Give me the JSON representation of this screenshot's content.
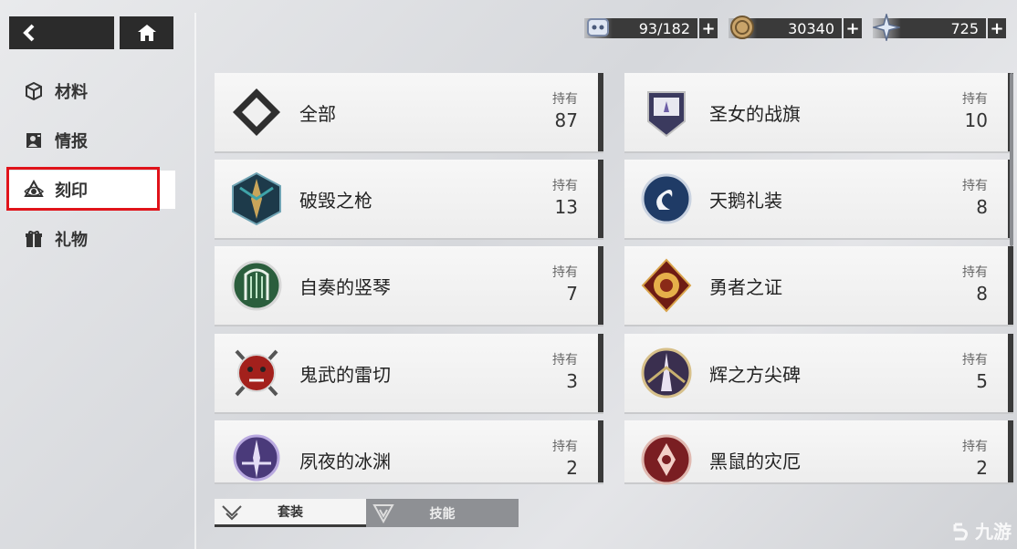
{
  "resources": [
    {
      "id": "stamina",
      "value": "93/182",
      "icon": "stamina-icon"
    },
    {
      "id": "coin",
      "value": "30340",
      "icon": "coin-icon"
    },
    {
      "id": "crystal",
      "value": "725",
      "icon": "crystal-icon"
    }
  ],
  "sidebar": {
    "items": [
      {
        "label": "材料",
        "icon": "cube-icon"
      },
      {
        "label": "情报",
        "icon": "profile-icon"
      },
      {
        "label": "刻印",
        "icon": "eye-emblem-icon",
        "active": true
      },
      {
        "label": "礼物",
        "icon": "gift-icon"
      }
    ]
  },
  "cards": {
    "hold_label": "持有",
    "items": [
      {
        "name": "全部",
        "count": "87",
        "icon": "all-diamond-icon"
      },
      {
        "name": "圣女的战旗",
        "count": "10",
        "icon": "banner-emblem-icon"
      },
      {
        "name": "破毁之枪",
        "count": "13",
        "icon": "spear-emblem-icon"
      },
      {
        "name": "天鹅礼装",
        "count": "8",
        "icon": "swan-emblem-icon"
      },
      {
        "name": "自奏的竖琴",
        "count": "7",
        "icon": "harp-emblem-icon"
      },
      {
        "name": "勇者之证",
        "count": "8",
        "icon": "lion-emblem-icon"
      },
      {
        "name": "鬼武的雷切",
        "count": "3",
        "icon": "oni-mask-emblem-icon"
      },
      {
        "name": "辉之方尖碑",
        "count": "5",
        "icon": "obelisk-emblem-icon"
      },
      {
        "name": "夙夜的冰渊",
        "count": "2",
        "icon": "ice-emblem-icon"
      },
      {
        "name": "黑鼠的灾厄",
        "count": "2",
        "icon": "rat-emblem-icon"
      }
    ]
  },
  "bottom_tabs": [
    {
      "label": "套装",
      "active": true
    },
    {
      "label": "技能",
      "active": false
    }
  ],
  "watermark": {
    "text": "九游"
  },
  "colors": {
    "accent_red": "#e0131a",
    "dark": "#2b2b2b"
  }
}
